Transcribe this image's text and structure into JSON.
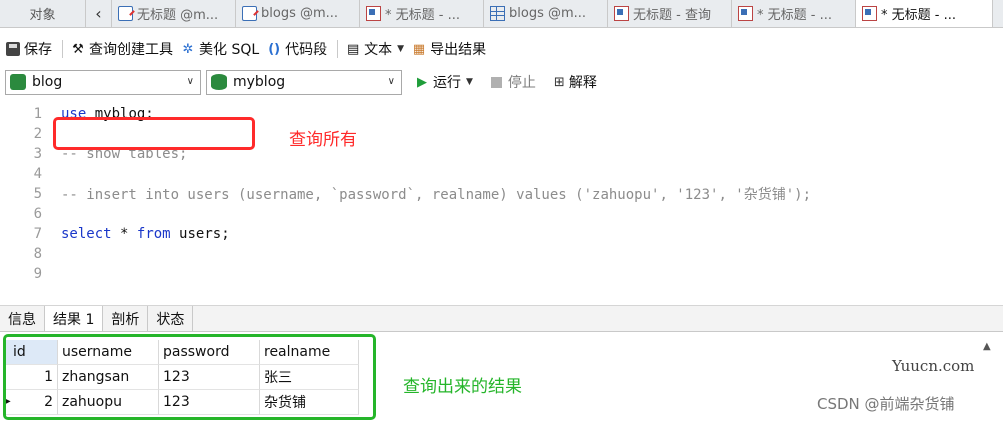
{
  "tabs": {
    "objects": "对象",
    "items": [
      {
        "label": "无标题 @m...",
        "icon": "query-icon"
      },
      {
        "label": "blogs @m...",
        "icon": "query-icon"
      },
      {
        "label": "* 无标题 - ...",
        "icon": "table-design-icon"
      },
      {
        "label": "blogs @m...",
        "icon": "table-icon"
      },
      {
        "label": "无标题 - 查询",
        "icon": "table-design-icon"
      },
      {
        "label": "* 无标题 - ...",
        "icon": "table-design-icon"
      },
      {
        "label": "* 无标题 - ...",
        "icon": "table-design-icon"
      }
    ]
  },
  "toolbar": {
    "save": "保存",
    "query_builder": "查询创建工具",
    "beautify": "美化 SQL",
    "snippet": "代码段",
    "text": "文本",
    "export": "导出结果"
  },
  "selectors": {
    "connection": "blog",
    "database": "myblog",
    "run": "运行",
    "stop": "停止",
    "explain": "解释"
  },
  "editor": {
    "lines": [
      {
        "n": "1",
        "text": "use myblog;"
      },
      {
        "n": "2",
        "text": ""
      },
      {
        "n": "3",
        "text": "-- show tables;"
      },
      {
        "n": "4",
        "text": ""
      },
      {
        "n": "5",
        "text": "-- insert into users (username, `password`, realname) values ('zahuopu', '123', '杂货铺');"
      },
      {
        "n": "6",
        "text": ""
      },
      {
        "n": "7",
        "text": "select * from users;"
      },
      {
        "n": "8",
        "text": ""
      },
      {
        "n": "9",
        "text": ""
      }
    ],
    "annotation": "查询所有"
  },
  "result_tabs": [
    "信息",
    "结果 1",
    "剖析",
    "状态"
  ],
  "result": {
    "columns": [
      "id",
      "username",
      "password",
      "realname"
    ],
    "rows": [
      [
        "1",
        "zhangsan",
        "123",
        "张三"
      ],
      [
        "2",
        "zahuopu",
        "123",
        "杂货铺"
      ]
    ],
    "annotation": "查询出来的结果"
  },
  "watermark": {
    "site": "Yuucn.com",
    "author": "CSDN @前端杂货铺"
  },
  "colors": {
    "keyword": "#1a37c9",
    "comment": "#8c8c8c",
    "highlight_red": "#ff2a2a",
    "highlight_green": "#25b52a"
  }
}
